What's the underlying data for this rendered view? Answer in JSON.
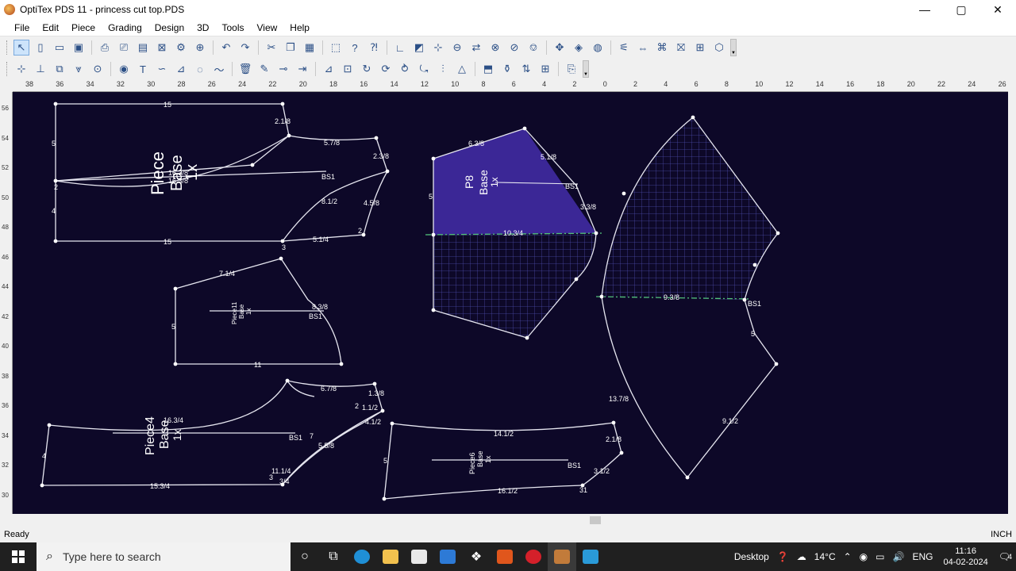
{
  "window": {
    "title": "OptiTex PDS 11 - princess cut top.PDS",
    "controls": {
      "minimize": "—",
      "maximize": "▢",
      "close": "✕"
    }
  },
  "menu": [
    {
      "label": "File",
      "name": "menu-file"
    },
    {
      "label": "Edit",
      "name": "menu-edit"
    },
    {
      "label": "Piece",
      "name": "menu-piece"
    },
    {
      "label": "Grading",
      "name": "menu-grading"
    },
    {
      "label": "Design",
      "name": "menu-design"
    },
    {
      "label": "3D",
      "name": "menu-3d"
    },
    {
      "label": "Tools",
      "name": "menu-tools"
    },
    {
      "label": "View",
      "name": "menu-view"
    },
    {
      "label": "Help",
      "name": "menu-help"
    }
  ],
  "toolbar1": [
    {
      "icon": "↖",
      "name": "select-tool-icon"
    },
    {
      "icon": "▯",
      "name": "new-file-icon"
    },
    {
      "icon": "▭",
      "name": "open-file-icon"
    },
    {
      "icon": "▣",
      "name": "save-icon"
    },
    {
      "icon": "⎙",
      "name": "print-icon"
    },
    {
      "icon": "⎚",
      "name": "plot-icon"
    },
    {
      "icon": "▤",
      "name": "export-icon"
    },
    {
      "icon": "⊠",
      "name": "excel-icon"
    },
    {
      "icon": "⚙",
      "name": "properties-icon"
    },
    {
      "icon": "⊕",
      "name": "zoom-icon"
    },
    {
      "icon": "↶",
      "name": "undo-icon"
    },
    {
      "icon": "↷",
      "name": "redo-icon"
    },
    {
      "icon": "✂",
      "name": "cut-icon"
    },
    {
      "icon": "❐",
      "name": "copy-icon"
    },
    {
      "icon": "▦",
      "name": "paste-icon"
    },
    {
      "icon": "⬚",
      "name": "marker-icon"
    },
    {
      "icon": "?",
      "name": "help-icon"
    },
    {
      "icon": "⁈",
      "name": "context-help-icon"
    },
    {
      "icon": "∟",
      "name": "axis-icon"
    },
    {
      "icon": "◩",
      "name": "fill-icon"
    },
    {
      "icon": "⊹",
      "name": "grid-icon"
    },
    {
      "icon": "⊖",
      "name": "measure-icon"
    },
    {
      "icon": "⇄",
      "name": "flip-icon"
    },
    {
      "icon": "⊗",
      "name": "rotate-icon"
    },
    {
      "icon": "⊘",
      "name": "lock-icon"
    },
    {
      "icon": "⎊",
      "name": "dart-icon"
    },
    {
      "icon": "✥",
      "name": "pleat-icon"
    },
    {
      "icon": "◈",
      "name": "notch-icon"
    },
    {
      "icon": "◍",
      "name": "drill-icon"
    },
    {
      "icon": "⚟",
      "name": "seam-icon"
    },
    {
      "icon": "⇔",
      "name": "width-icon"
    },
    {
      "icon": "⌘",
      "name": "hem-icon"
    },
    {
      "icon": "⛝",
      "name": "mirror-icon"
    },
    {
      "icon": "⊞",
      "name": "arrange-icon"
    },
    {
      "icon": "⬡",
      "name": "shape-icon"
    }
  ],
  "toolbar2": [
    {
      "icon": "⊹",
      "name": "add-point-icon"
    },
    {
      "icon": "⊥",
      "name": "perpendicular-icon"
    },
    {
      "icon": "⧉",
      "name": "image-icon"
    },
    {
      "icon": "⩔",
      "name": "dart-tool-icon"
    },
    {
      "icon": "⊙",
      "name": "circle-icon"
    },
    {
      "icon": "◉",
      "name": "button-icon"
    },
    {
      "icon": "T",
      "name": "text-icon"
    },
    {
      "icon": "∽",
      "name": "curve-icon"
    },
    {
      "icon": "⊿",
      "name": "angle-icon"
    },
    {
      "icon": "◌",
      "name": "lasso-icon"
    },
    {
      "icon": "〜",
      "name": "wave-icon"
    },
    {
      "icon": "🗑",
      "name": "delete-icon"
    },
    {
      "icon": "✎",
      "name": "pen-icon"
    },
    {
      "icon": "⊸",
      "name": "move-point-icon"
    },
    {
      "icon": "⇥",
      "name": "offset-icon"
    },
    {
      "icon": "⊿",
      "name": "slope-icon"
    },
    {
      "icon": "⊡",
      "name": "frame-icon"
    },
    {
      "icon": "↻",
      "name": "rotate-piece-icon"
    },
    {
      "icon": "⟳",
      "name": "refresh-icon"
    },
    {
      "icon": "⥁",
      "name": "spin-icon"
    },
    {
      "icon": "⤿",
      "name": "arc-icon"
    },
    {
      "icon": "⫶",
      "name": "grade-icon"
    },
    {
      "icon": "△",
      "name": "triangle-icon"
    },
    {
      "icon": "⬒",
      "name": "piece-info-icon"
    },
    {
      "icon": "⚱",
      "name": "bag-icon"
    },
    {
      "icon": "⇅",
      "name": "swap-icon"
    },
    {
      "icon": "⊞",
      "name": "layout-icon"
    },
    {
      "icon": "⎘",
      "name": "duplicate-icon"
    }
  ],
  "ruler": {
    "top_labels": [
      "38",
      "36",
      "34",
      "32",
      "30",
      "28",
      "26",
      "24",
      "22",
      "20",
      "18",
      "16",
      "14",
      "12",
      "10",
      "8",
      "6",
      "4",
      "2",
      "0",
      "2",
      "4",
      "6",
      "8",
      "10",
      "12",
      "14",
      "16",
      "18",
      "20",
      "22",
      "24",
      "26"
    ],
    "left_labels": [
      "56",
      "54",
      "52",
      "50",
      "48",
      "46",
      "44",
      "42",
      "40",
      "38",
      "36",
      "34",
      "32",
      "30"
    ]
  },
  "pieces": [
    {
      "name": "piece-front",
      "labels": [
        "15",
        "2.1/8",
        "5.7/8",
        "2.3/8",
        "16.3/8",
        "16.3/8",
        "BS1",
        "2",
        "8.1/2",
        "4.5/8",
        "5",
        "4",
        "15",
        "3",
        "5.1/4",
        "2"
      ],
      "title_lines": [
        "Piece",
        "Base",
        "1x"
      ]
    },
    {
      "name": "piece-8",
      "labels": [
        "6.3/8",
        "5.1/8",
        "5",
        "BS1",
        "3.3/8",
        "10.3/4"
      ],
      "title_lines": [
        "P8",
        "Base",
        "1x"
      ]
    },
    {
      "name": "piece-11",
      "labels": [
        "7.1/4",
        "8.3/8",
        "BS1",
        "5",
        "11"
      ],
      "title_lines": [
        "Piece11",
        "Base",
        "1x"
      ]
    },
    {
      "name": "piece-sleeve",
      "labels": [
        "9.3/8",
        "BS1",
        "5",
        "13.7/8",
        "9.1/2"
      ]
    },
    {
      "name": "piece-4",
      "labels": [
        "6.7/8",
        "1.3/8",
        "16.3/4",
        "2",
        "1.1/2",
        "4.1/2",
        "BS1",
        "7",
        "5.5/8",
        "4",
        "11.1/4",
        "3",
        "3/4",
        "15.3/4"
      ],
      "title_lines": [
        "Piece4",
        "Base",
        "1x"
      ]
    },
    {
      "name": "piece-6",
      "labels": [
        "14.1/2",
        "2.1/8",
        "5",
        "BS1",
        "3.1/2",
        "16.1/2",
        "31"
      ],
      "title_lines": [
        "Piece6",
        "Base",
        "1x"
      ]
    }
  ],
  "status": {
    "left": "Ready",
    "right": "INCH"
  },
  "taskbar": {
    "search_placeholder": "Type here to search",
    "desktop_label": "Desktop",
    "weather": "14°C",
    "language": "ENG",
    "time": "11:16",
    "date": "04-02-2024",
    "notification_count": "4"
  },
  "colors": {
    "canvas": "#0d0828",
    "outline": "#e6e6f0",
    "fill_solid": "#3b2796",
    "grid": "#4a4aa8",
    "midline": "#52c07a"
  }
}
